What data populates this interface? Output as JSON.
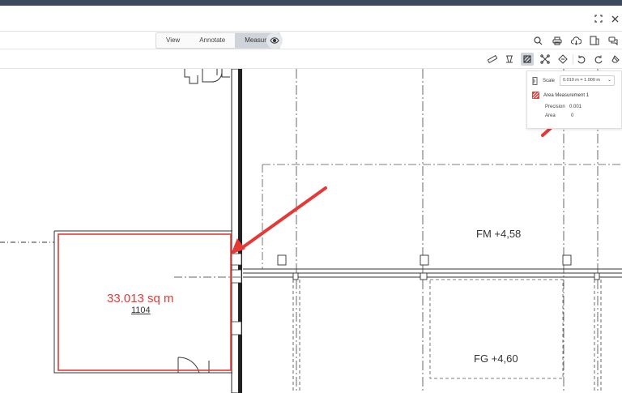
{
  "window": {
    "fullscreen_icon": "fullscreen-icon",
    "close_icon": "close-icon"
  },
  "modes": {
    "tabs": [
      {
        "label": "View"
      },
      {
        "label": "Annotate"
      },
      {
        "label": "Measure"
      }
    ],
    "active": "Measure",
    "visibility_icon": "eye-icon"
  },
  "actions": [
    "search-icon",
    "print-icon",
    "cloud-download-icon",
    "compare-icon",
    "comments-icon"
  ],
  "measure_tools": [
    "ruler-icon",
    "polyline-icon",
    "area-icon",
    "perimeter-icon",
    "calibrate-icon",
    "undo-icon",
    "redo-icon",
    "eraser-icon"
  ],
  "measure_panel": {
    "scale_label": "Scale",
    "scale_value": "0.010 m = 1.000 m",
    "measurement_title": "Area Measurement 1",
    "precision_label": "Precision",
    "precision_value": "0.001",
    "area_label": "Area",
    "area_value": "0"
  },
  "drawing": {
    "area_label": "33.013 sq m",
    "room_number": "1104",
    "level_fm": "FM +4,58",
    "level_fg": "FG +4,60"
  },
  "colors": {
    "header": "#3b4a5c",
    "active_tab": "#cfd4da",
    "measure_red": "#e53935",
    "annotation_arrow": "#e53935",
    "drawing_line": "#333333"
  }
}
